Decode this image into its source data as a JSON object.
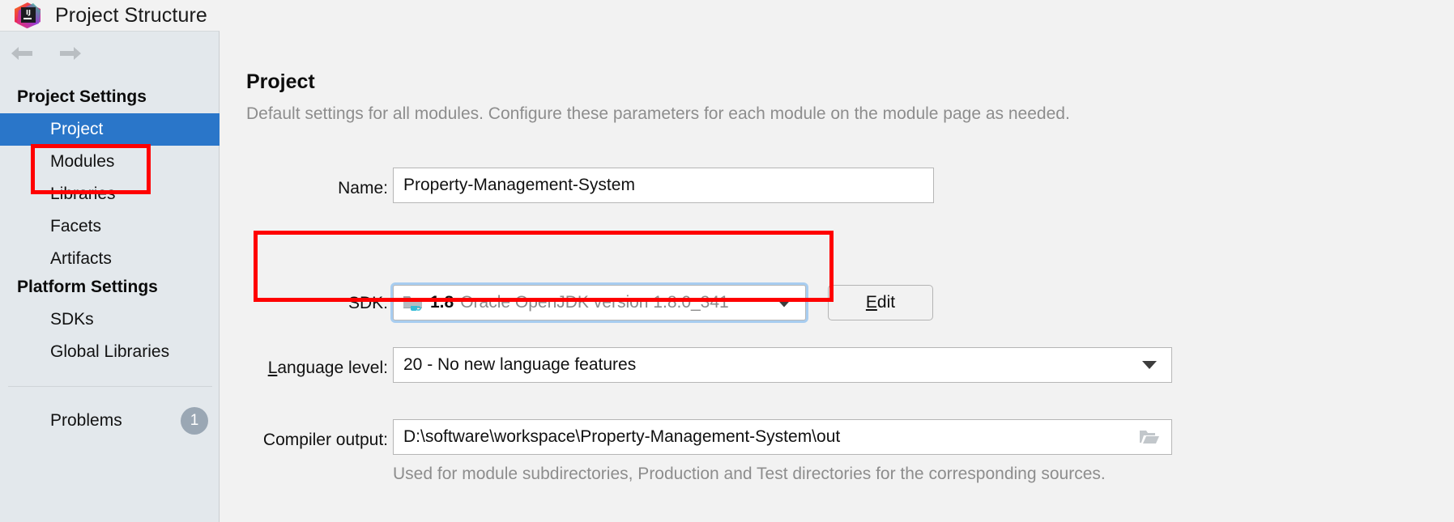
{
  "window": {
    "title": "Project Structure",
    "logo_icon": "intellij-idea-logo"
  },
  "navigation": {
    "back_icon": "arrow-left-icon",
    "forward_icon": "arrow-right-icon"
  },
  "sidebar": {
    "groups": [
      {
        "label": "Project Settings"
      },
      {
        "label": "Platform Settings"
      }
    ],
    "items": [
      {
        "label": "Project",
        "selected": true
      },
      {
        "label": "Modules",
        "selected": false
      },
      {
        "label": "Libraries",
        "selected": false
      },
      {
        "label": "Facets",
        "selected": false
      },
      {
        "label": "Artifacts",
        "selected": false
      },
      {
        "label": "SDKs",
        "selected": false
      },
      {
        "label": "Global Libraries",
        "selected": false
      }
    ],
    "problems": {
      "label": "Problems",
      "badge_count": "1"
    }
  },
  "main": {
    "title": "Project",
    "description": "Default settings for all modules. Configure these parameters for each module on the module page as needed.",
    "fields": {
      "name": {
        "label": "Name:",
        "value": "Property-Management-System"
      },
      "sdk": {
        "label": "SDK:",
        "icon": "java-sdk-folder-icon",
        "version": "1.8",
        "description": "Oracle OpenJDK version 1.8.0_341",
        "dropdown_icon": "chevron-down-icon",
        "edit_button": {
          "mnemonic": "E",
          "rest": "dit"
        }
      },
      "language_level": {
        "label_mnemonic": "L",
        "label_rest": "anguage level:",
        "value": "20 - No new language features",
        "dropdown_icon": "chevron-down-icon"
      },
      "compiler_output": {
        "label": "Compiler output:",
        "value": "D:\\software\\workspace\\Property-Management-System\\out",
        "browse_icon": "folder-open-icon",
        "hint": "Used for module subdirectories, Production and Test directories for the corresponding sources."
      }
    }
  },
  "annotations": {
    "highlight_color": "#ff0000",
    "boxes": [
      {
        "target": "sidebar-item-project"
      },
      {
        "target": "sdk-row"
      }
    ]
  },
  "colors": {
    "accent_selection": "#2a76c9",
    "sidebar_bg": "#e3e8ec",
    "main_bg": "#f2f2f2",
    "annotation_red": "#ff0000",
    "muted_text": "#8d8d8d"
  }
}
